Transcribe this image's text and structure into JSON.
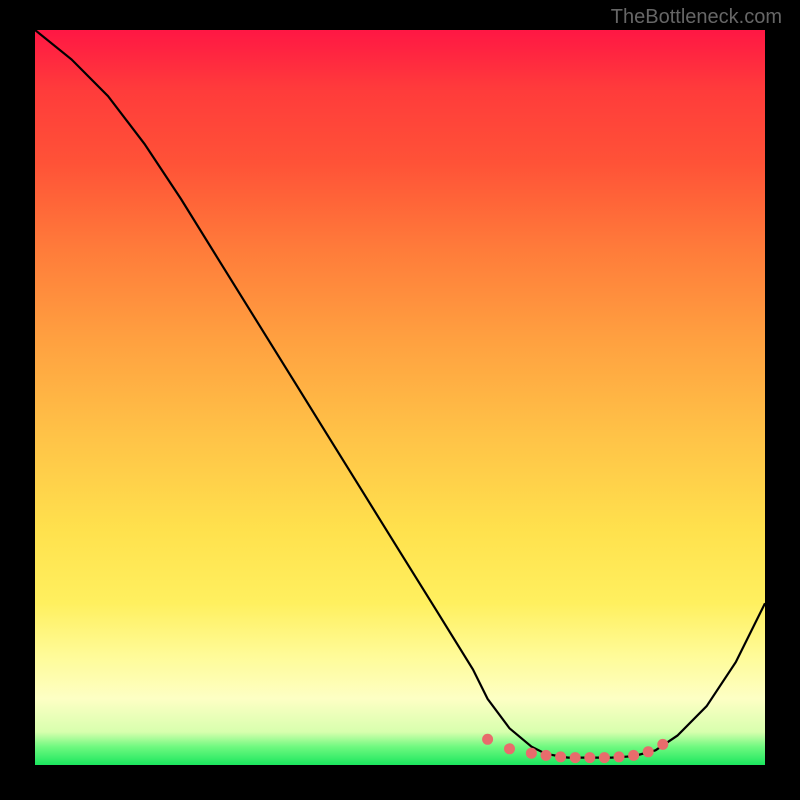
{
  "watermark": "TheBottleneck.com",
  "chart_data": {
    "type": "line",
    "title": "",
    "xlabel": "",
    "ylabel": "",
    "xlim": [
      0,
      100
    ],
    "ylim": [
      0,
      100
    ],
    "series": [
      {
        "name": "bottleneck-curve",
        "x": [
          0,
          5,
          10,
          15,
          20,
          25,
          30,
          35,
          40,
          45,
          50,
          55,
          60,
          62,
          65,
          68,
          70,
          73,
          76,
          79,
          82,
          85,
          88,
          92,
          96,
          100
        ],
        "y": [
          100,
          96,
          91,
          84.5,
          77,
          69,
          61,
          53,
          45,
          37,
          29,
          21,
          13,
          9,
          5,
          2.5,
          1.5,
          1,
          1,
          1,
          1.2,
          2,
          4,
          8,
          14,
          22
        ]
      }
    ],
    "markers": {
      "name": "optimal-range",
      "color": "#e86c6c",
      "x": [
        62,
        65,
        68,
        70,
        72,
        74,
        76,
        78,
        80,
        82,
        84,
        86
      ],
      "y": [
        3.5,
        2.2,
        1.6,
        1.3,
        1.1,
        1.0,
        1.0,
        1.0,
        1.1,
        1.3,
        1.8,
        2.8
      ]
    },
    "background_gradient": {
      "top": "#ff1744",
      "middle": "#ffc247",
      "bottom": "#1be65e"
    }
  }
}
